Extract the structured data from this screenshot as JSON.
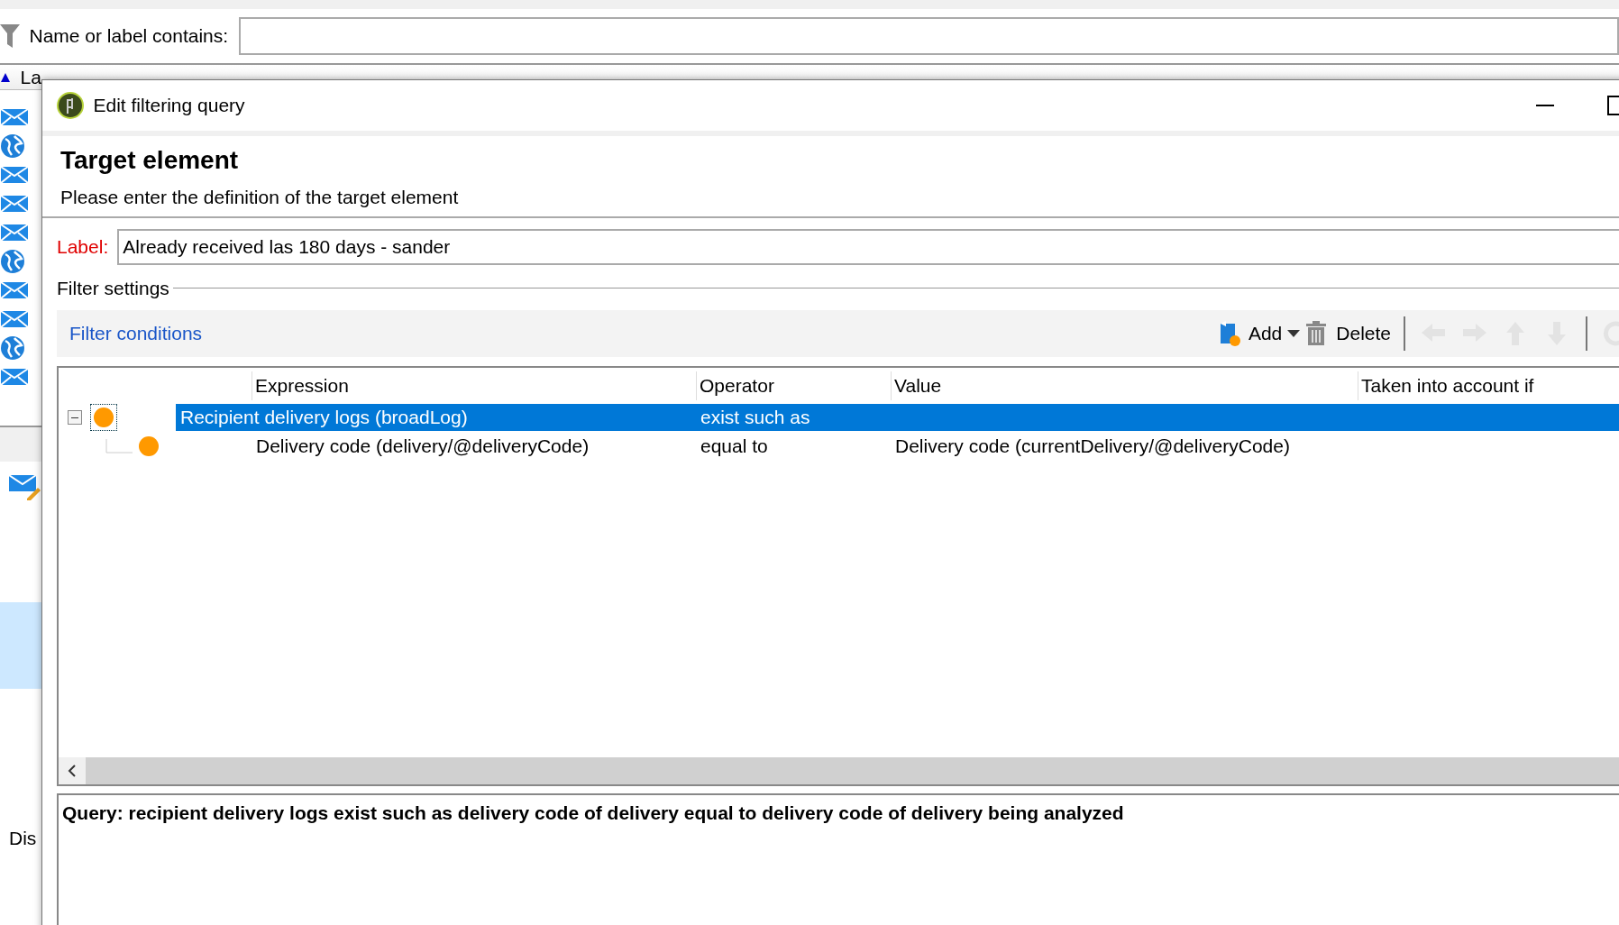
{
  "filter_bar": {
    "label": "Name or label contains:"
  },
  "list": {
    "sort_column": {
      "label": "La",
      "sorted": true
    },
    "rows": [
      {
        "kind": "mail"
      },
      {
        "kind": "globe"
      },
      {
        "kind": "mail"
      },
      {
        "kind": "mail"
      },
      {
        "kind": "mail"
      },
      {
        "kind": "globe"
      },
      {
        "kind": "mail"
      },
      {
        "kind": "mail"
      },
      {
        "kind": "globe"
      },
      {
        "kind": "mail"
      }
    ],
    "bottom_label": "Dis"
  },
  "dialog": {
    "title": "Edit filtering query",
    "header": {
      "title": "Target element",
      "subtitle": "Please enter the definition of the target element"
    },
    "label_field": {
      "label": "Label:",
      "value": "Already received las 180 days - sander"
    },
    "filter_settings": {
      "legend": "Filter settings",
      "toolbar": {
        "title": "Filter conditions",
        "buttons": [
          {
            "kind": "add",
            "label": "Add",
            "disabled": false
          },
          {
            "kind": "delete",
            "label": "Delete",
            "disabled": false
          },
          {
            "kind": "separator"
          },
          {
            "kind": "left",
            "disabled": true
          },
          {
            "kind": "right",
            "disabled": true
          },
          {
            "kind": "up",
            "disabled": true
          },
          {
            "kind": "down",
            "disabled": true
          },
          {
            "kind": "separator"
          },
          {
            "kind": "refresh",
            "disabled": true
          }
        ]
      },
      "grid": {
        "columns": [
          "Expression",
          "Operator",
          "Value",
          "Taken into account if"
        ],
        "rows": [
          {
            "expression": "Recipient delivery logs (broadLog)",
            "operator": "exist such as",
            "selected": true,
            "expanded": true,
            "children": [
              {
                "expression": "Delivery code (delivery/@deliveryCode)",
                "operator": "equal to",
                "value": "Delivery code (currentDelivery/@deliveryCode)",
                "selected": false
              }
            ]
          }
        ]
      }
    },
    "query": "Query: recipient delivery logs exist such as delivery code of delivery equal to delivery code of delivery being analyzed"
  }
}
